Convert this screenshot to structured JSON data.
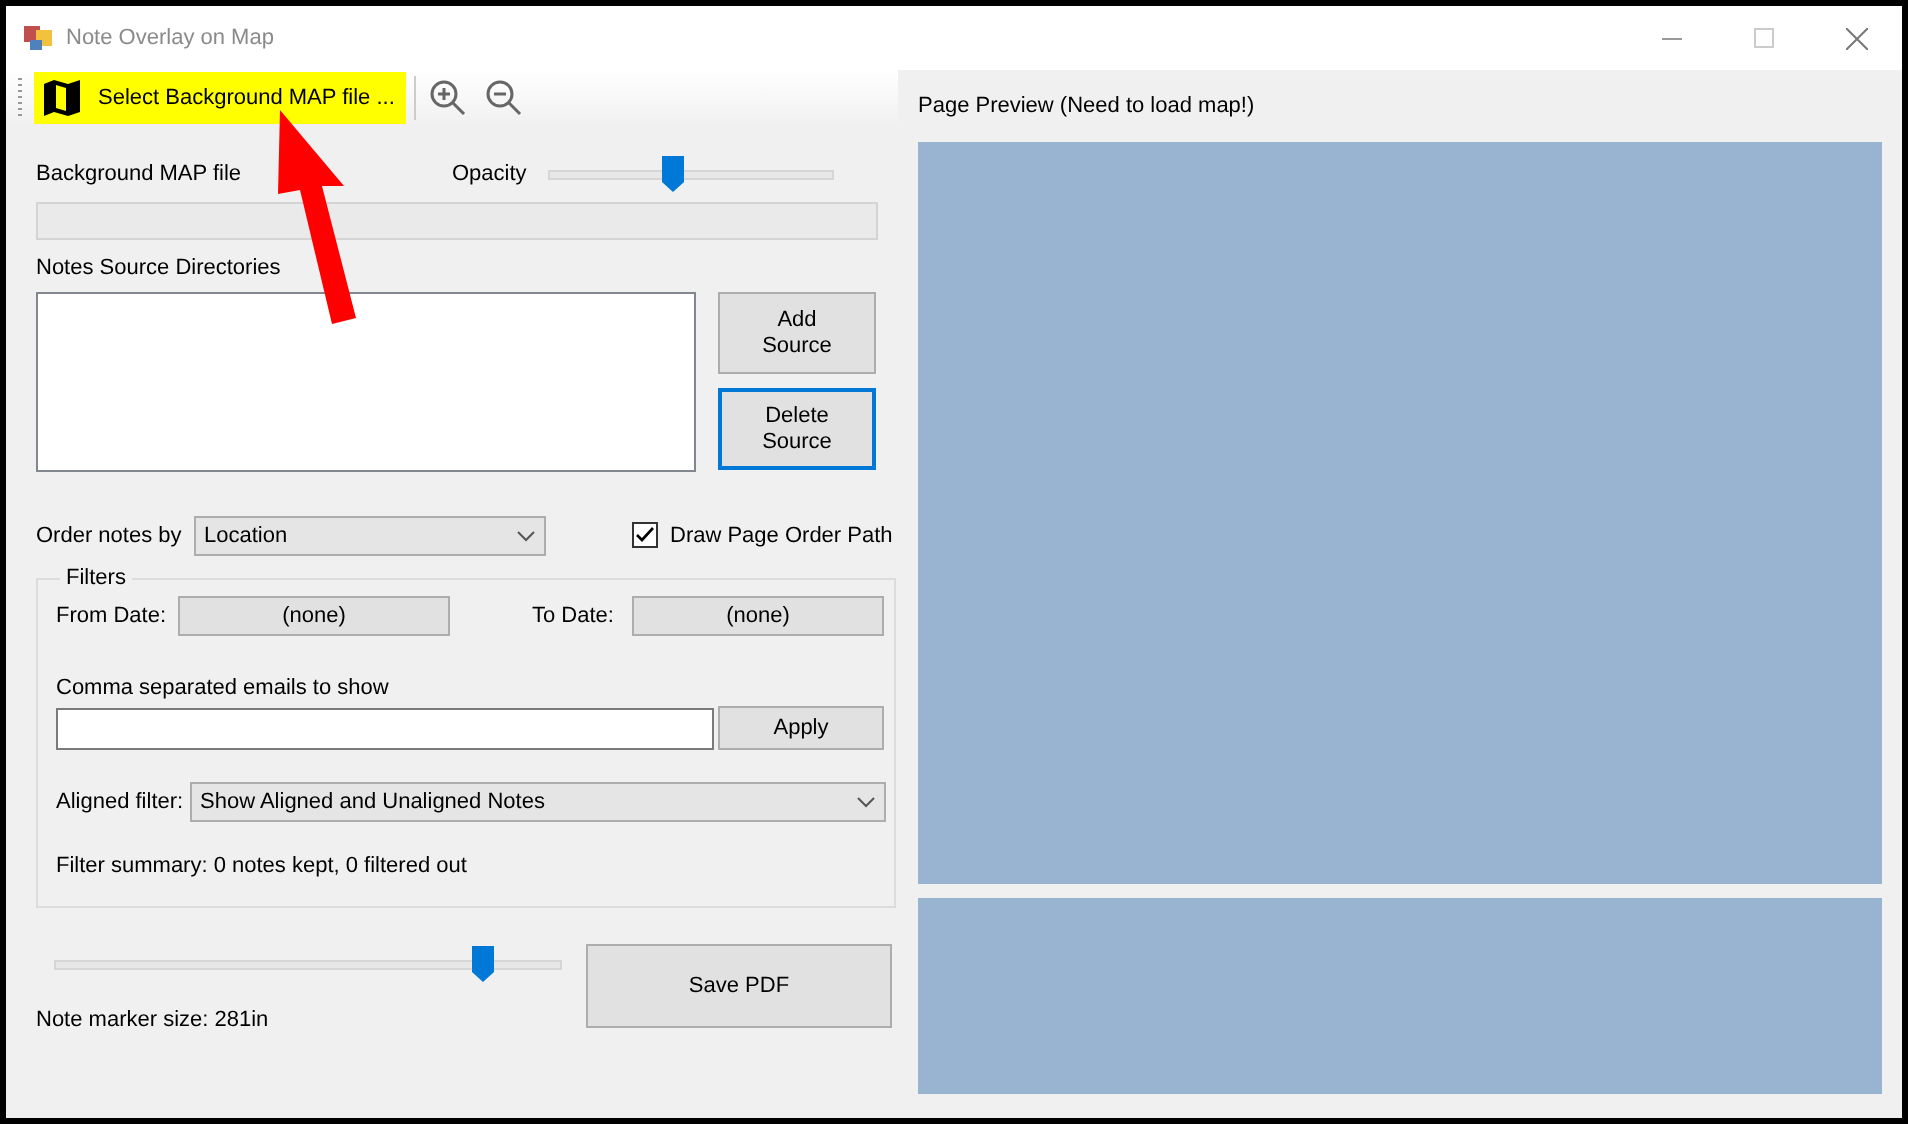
{
  "window": {
    "title": "Note Overlay on Map"
  },
  "toolbar": {
    "select_map_button": {
      "label": "Select Background MAP file ...",
      "highlighted": true
    }
  },
  "map_file": {
    "label": "Background MAP file"
  },
  "opacity": {
    "label": "Opacity",
    "level": 0.43
  },
  "sources": {
    "label": "Notes Source Directories",
    "buttons": [
      {
        "label": "Add Source",
        "focused": false
      },
      {
        "label": "Delete Source",
        "focused": true
      }
    ]
  },
  "order": {
    "label": "Order notes by",
    "value": "Location"
  },
  "draw_path": {
    "label": "Draw Page Order Path",
    "checked": true
  },
  "filters": {
    "title": "Filters",
    "from_label": "From Date:",
    "from_value": "(none)",
    "to_label": "To Date:",
    "to_value": "(none)",
    "emails_label": "Comma separated emails to show",
    "apply": "Apply",
    "aligned_label": "Aligned filter:",
    "aligned_value": "Show Aligned and Unaligned Notes",
    "summary": "Filter summary: 0 notes kept, 0 filtered out"
  },
  "marker": {
    "level": 0.86,
    "label": "Note marker size: 281in"
  },
  "save": "Save PDF",
  "preview": {
    "title": "Page Preview (Need to load map!)"
  }
}
